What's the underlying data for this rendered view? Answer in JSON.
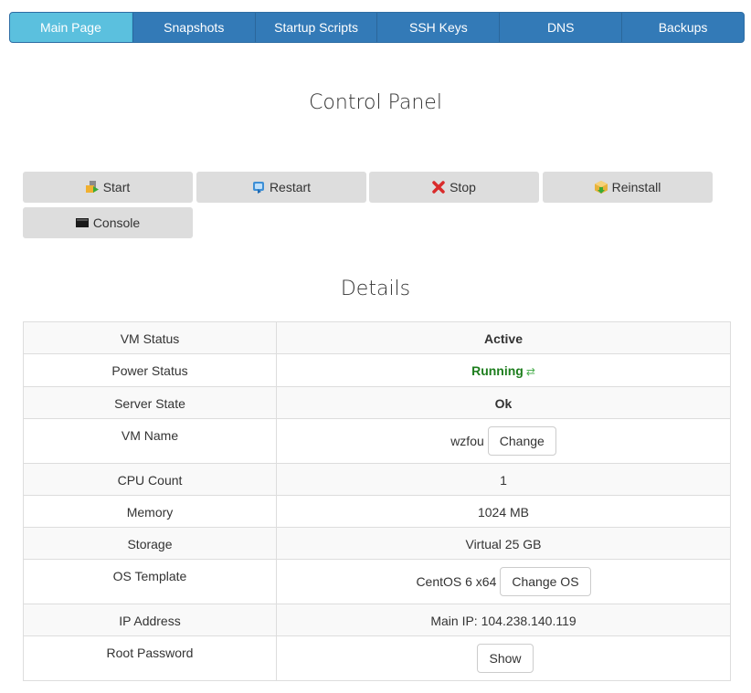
{
  "nav": {
    "tabs": [
      {
        "label": "Main Page",
        "active": true
      },
      {
        "label": "Snapshots",
        "active": false
      },
      {
        "label": "Startup Scripts",
        "active": false
      },
      {
        "label": "SSH Keys",
        "active": false
      },
      {
        "label": "DNS",
        "active": false
      },
      {
        "label": "Backups",
        "active": false
      }
    ]
  },
  "control_panel": {
    "title": "Control Panel",
    "actions": [
      {
        "label": "Start",
        "icon": "start-icon"
      },
      {
        "label": "Restart",
        "icon": "restart-icon"
      },
      {
        "label": "Stop",
        "icon": "stop-icon"
      },
      {
        "label": "Reinstall",
        "icon": "reinstall-icon"
      },
      {
        "label": "Console",
        "icon": "console-icon"
      }
    ]
  },
  "details": {
    "title": "Details",
    "rows": [
      {
        "label": "VM Status",
        "value": "Active"
      },
      {
        "label": "Power Status",
        "value": "Running",
        "icon": "refresh-icon"
      },
      {
        "label": "Server State",
        "value": "Ok"
      },
      {
        "label": "VM Name",
        "value": "wzfou",
        "button": "Change"
      },
      {
        "label": "CPU Count",
        "value": "1"
      },
      {
        "label": "Memory",
        "value": "1024 MB"
      },
      {
        "label": "Storage",
        "value": "Virtual 25 GB"
      },
      {
        "label": "OS Template",
        "value": "CentOS 6 x64",
        "button": "Change OS"
      },
      {
        "label": "IP Address",
        "value": "Main IP: 104.238.140.119"
      },
      {
        "label": "Root Password",
        "value": "",
        "button": "Show"
      }
    ]
  },
  "colors": {
    "nav_bg": "#337ab7",
    "nav_active": "#5bc0de",
    "running_green": "#1e7e1e",
    "action_button_bg": "#dddddd"
  }
}
